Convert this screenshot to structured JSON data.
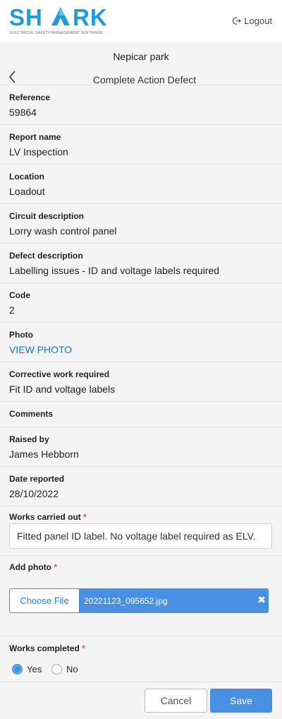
{
  "header": {
    "logo_text": "SHARK",
    "logo_tagline": "ELECTRICAL SAFETY MANAGEMENT SOFTWARE",
    "logout_label": "Logout"
  },
  "page": {
    "site_name": "Nepicar park",
    "title": "Complete Action Defect"
  },
  "fields": [
    {
      "label": "Reference",
      "value": "59864"
    },
    {
      "label": "Report name",
      "value": "LV Inspection"
    },
    {
      "label": "Location",
      "value": "Loadout"
    },
    {
      "label": "Circuit description",
      "value": "Lorry wash control panel"
    },
    {
      "label": "Defect description",
      "value": "Labelling issues - ID and voltage labels required"
    },
    {
      "label": "Code",
      "value": "2"
    },
    {
      "label": "Photo",
      "value": "VIEW PHOTO"
    },
    {
      "label": "Corrective work required",
      "value": "Fit ID and voltage labels"
    },
    {
      "label": "Comments",
      "value": ""
    },
    {
      "label": "Raised by",
      "value": "James Hebborn"
    },
    {
      "label": "Date reported",
      "value": "28/10/2022"
    }
  ],
  "works_carried_out": {
    "label": "Works carried out",
    "required_mark": "*",
    "value": "Fitted panel ID label. No voltage label required as ELV."
  },
  "add_photo": {
    "label": "Add photo",
    "required_mark": "*",
    "choose_label": "Choose File",
    "file_name": "20221123_095652.jpg",
    "clear_glyph": "✖"
  },
  "works_completed": {
    "label": "Works completed",
    "required_mark": "*",
    "options": [
      "Yes",
      "No"
    ],
    "selected": "Yes"
  },
  "footer": {
    "cancel_label": "Cancel",
    "save_label": "Save"
  },
  "colors": {
    "accent": "#4a90e2",
    "link": "#1a73c9",
    "required": "#d9534f"
  }
}
